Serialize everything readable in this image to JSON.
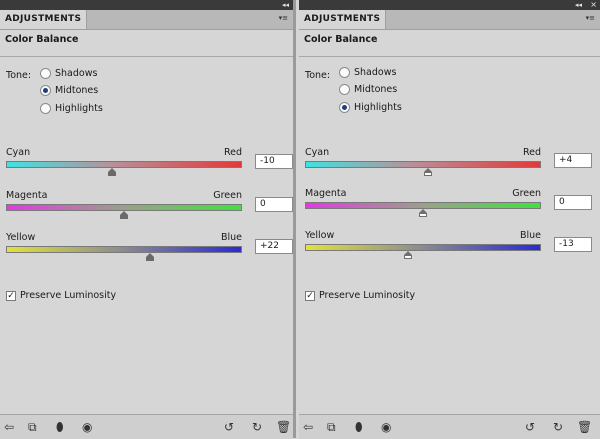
{
  "panels": [
    {
      "tab": "ADJUSTMENTS",
      "title_icons": "◂◂",
      "menu_icon": "▾≡",
      "heading": "Color Balance",
      "tone_label": "Tone:",
      "tones": [
        {
          "label": "Shadows",
          "selected": false
        },
        {
          "label": "Midtones",
          "selected": true
        },
        {
          "label": "Highlights",
          "selected": false
        }
      ],
      "sliders": [
        {
          "left": "Cyan",
          "right": "Red",
          "value": "-10",
          "level": -10
        },
        {
          "left": "Magenta",
          "right": "Green",
          "value": "0",
          "level": 0
        },
        {
          "left": "Yellow",
          "right": "Blue",
          "value": "+22",
          "level": 22
        }
      ],
      "preserve": {
        "label": "Preserve Luminosity",
        "checked": true
      }
    },
    {
      "tab": "ADJUSTMENTS",
      "title_icons": "◂◂",
      "menu_icon": "▾≡",
      "close": "×",
      "heading": "Color Balance",
      "tone_label": "Tone:",
      "tones": [
        {
          "label": "Shadows",
          "selected": false
        },
        {
          "label": "Midtones",
          "selected": false
        },
        {
          "label": "Highlights",
          "selected": true
        }
      ],
      "sliders": [
        {
          "left": "Cyan",
          "right": "Red",
          "value": "+4",
          "level": 4
        },
        {
          "left": "Magenta",
          "right": "Green",
          "value": "0",
          "level": 0
        },
        {
          "left": "Yellow",
          "right": "Blue",
          "value": "-13",
          "level": -13
        }
      ],
      "preserve": {
        "label": "Preserve Luminosity",
        "checked": true
      }
    }
  ],
  "bottom_icons": [
    "back-arrow-icon",
    "clip-layer-icon",
    "mask-icon",
    "visibility-eye-icon",
    "previous-state-icon",
    "reset-icon",
    "trash-icon"
  ],
  "bottom_glyphs": {
    "back": "⇦",
    "clip": "⧉",
    "mask": "⬮",
    "eye": "◉",
    "prev": "↺",
    "reset": "↻",
    "trash": "🗑"
  },
  "colors": {
    "radio_dot": "#203e7a",
    "panel_bg": "#d6d6d6",
    "title_bar": "#3a3a3a"
  }
}
